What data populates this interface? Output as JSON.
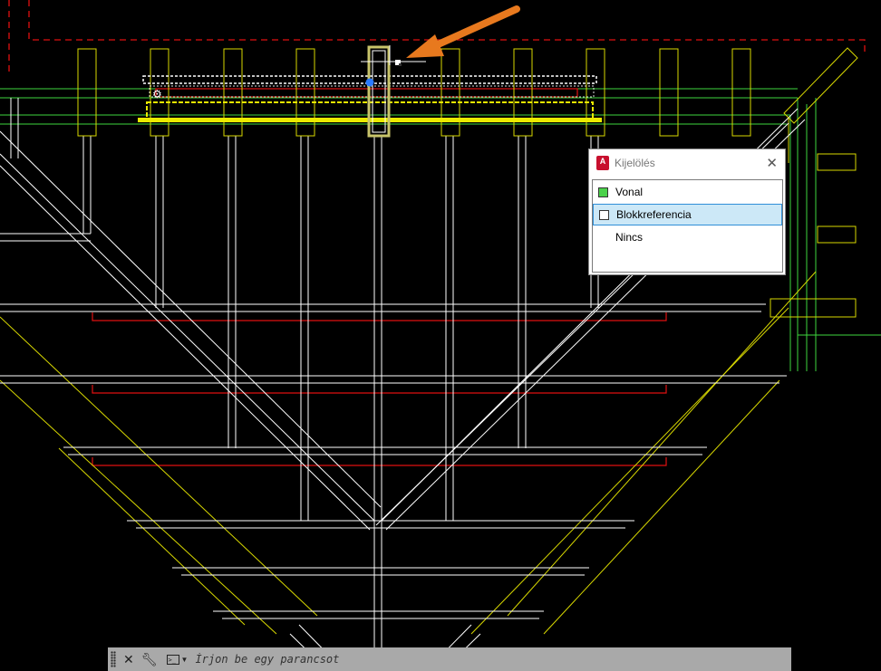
{
  "colors": {
    "background": "#000000",
    "white_lines": "#ffffff",
    "yellow_lines": "#d9d900",
    "red_lines": "#e01010",
    "green_lines": "#3ed63e",
    "orange_arrow": "#e8791e",
    "selection_blue": "#cce8f7"
  },
  "selection_popup": {
    "app_icon": "autocad-a-icon",
    "app_icon_letter": "A",
    "title": "Kijelölés",
    "close_icon": "close-x-icon",
    "items": [
      {
        "label": "Vonal",
        "swatch_color": "#4bd14b",
        "selected": false
      },
      {
        "label": "Blokkreferencia",
        "swatch_color": "#ffffff",
        "selected": true
      },
      {
        "label": "Nincs",
        "swatch_color": null,
        "selected": false
      }
    ]
  },
  "command_line": {
    "close_icon": "close-icon",
    "settings_icon": "wrench-icon",
    "prompt_icon": "command-prompt-icon",
    "prompt_icon_text": ">_",
    "placeholder": "Írjon be egy parancsot"
  },
  "annotation": {
    "arrow_icon": "orange-arrow"
  }
}
